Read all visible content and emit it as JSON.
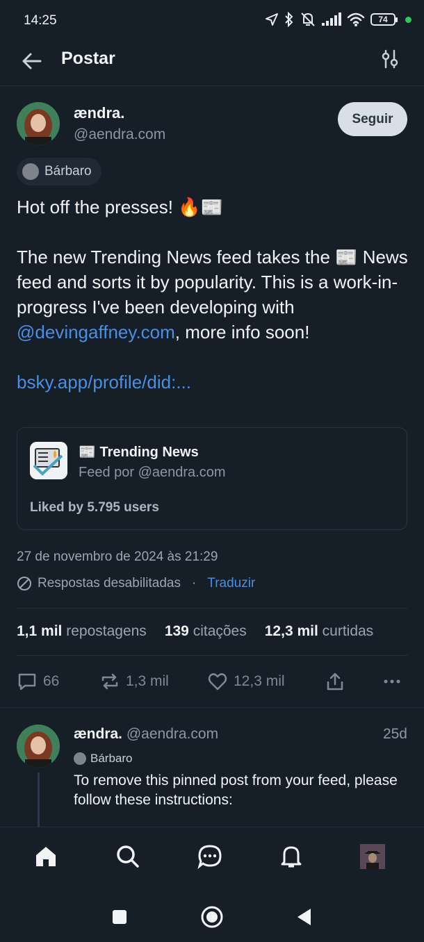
{
  "status": {
    "time": "14:25",
    "battery": "74"
  },
  "header": {
    "title": "Postar"
  },
  "post": {
    "author_name": "ændra.",
    "author_handle": "@aendra.com",
    "follow_label": "Seguir",
    "label": "Bárbaro",
    "text_line1": "Hot off the presses! 🔥📰",
    "text_body_before_link": "The new Trending News feed takes the 📰 News feed and sorts it by popularity. This is a work-in-progress I've been developing with ",
    "mention": "@devingaffney.com",
    "text_body_after_link": ", more info soon!",
    "url_text": "bsky.app/profile/did:...",
    "timestamp": "27 de novembro de 2024 às 21:29",
    "replies_disabled": "Respostas desabilitadas",
    "separator": "·",
    "translate": "Traduzir"
  },
  "embed": {
    "title": "📰 Trending News",
    "by": "Feed por @aendra.com",
    "likes": "Liked by 5.795 users"
  },
  "stats": {
    "reposts_count": "1,1 mil",
    "reposts_label": "repostagens",
    "quotes_count": "139",
    "quotes_label": "citações",
    "likes_count": "12,3 mil",
    "likes_label": "curtidas"
  },
  "actions": {
    "replies": "66",
    "reposts": "1,3 mil",
    "likes": "12,3 mil"
  },
  "reply": {
    "author_name": "ændra.",
    "author_handle": "@aendra.com",
    "age": "25d",
    "label": "Bárbaro",
    "text": "To remove this pinned post from your feed, please follow these instructions:"
  },
  "colors": {
    "background": "#161e27",
    "accent": "#4a90e2",
    "follow_bg": "#d9dfe6"
  },
  "icons": [
    "arrow-left-icon",
    "sliders-icon",
    "comment-icon",
    "repost-icon",
    "heart-icon",
    "share-icon",
    "more-icon",
    "home-icon",
    "search-icon",
    "chat-icon",
    "bell-icon"
  ]
}
